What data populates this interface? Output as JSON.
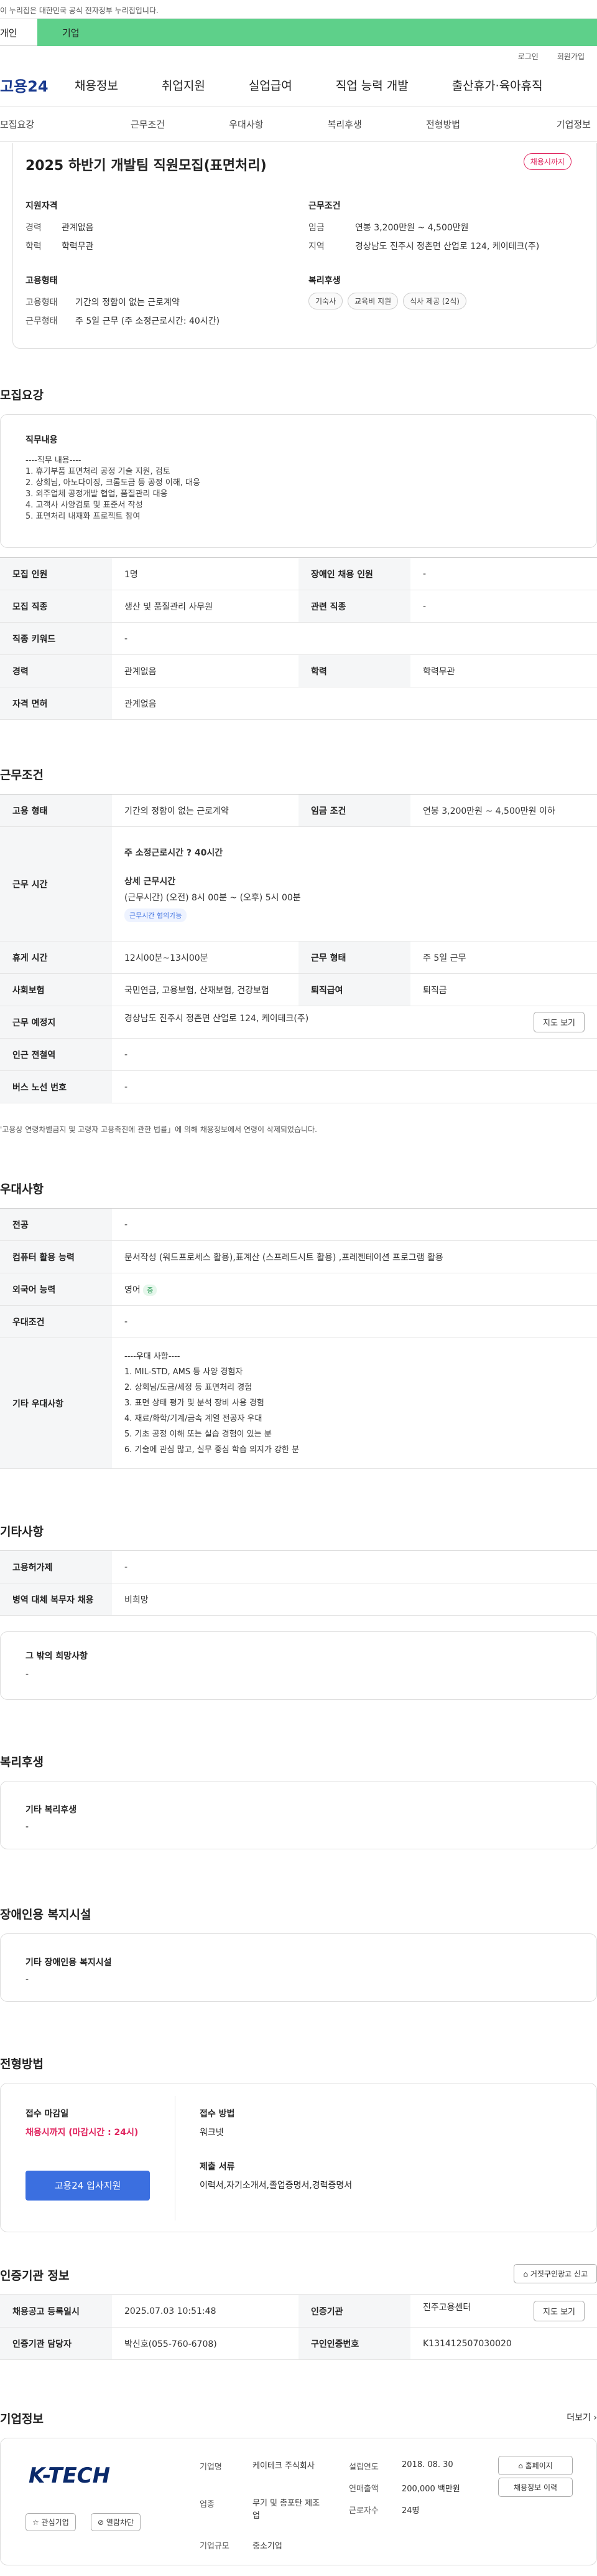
{
  "gov_banner": "이 누리집은 대한민국 공식 전자정부 누리집입니다.",
  "topbar": {
    "tab_personal": "개인",
    "tab_company": "기업"
  },
  "util": {
    "login": "로그인",
    "signup": "회원가입"
  },
  "gnb": {
    "logo": "고용24",
    "items": [
      "채용정보",
      "취업지원",
      "실업급여",
      "직업 능력 개발",
      "출산휴가·육아휴직"
    ]
  },
  "subnav": [
    "모집요강",
    "근무조건",
    "우대사항",
    "복리후생",
    "전형방법",
    "기업정보"
  ],
  "summary": {
    "title": "2025 하반기 개발팀 직원모집(표면처리)",
    "status": "채용시까지",
    "qual_title": "지원자격",
    "career_label": "경력",
    "career": "관계없음",
    "edu_label": "학력",
    "edu": "학력무관",
    "cond_title": "근무조건",
    "wage_label": "임금",
    "wage": "연봉 3,200만원 ~ 4,500만원",
    "region_label": "지역",
    "region": "경상남도 진주시 정촌면 산업로 124, 케이테크(주)",
    "emp_title": "고용형태",
    "emp_type_label": "고용형태",
    "emp_type": "기간의 정함이 없는 근로계약",
    "work_label": "근무형태",
    "work": "주 5일 근무 (주 소정근로시간: 40시간)",
    "welfare_title": "복리후생",
    "welfare_tags": [
      "기숙사",
      "교육비 지원",
      "식사 제공 (2식)"
    ]
  },
  "recruit": {
    "title": "모집요강",
    "duty_title": "직무내용",
    "duty_lines": [
      "----직무 내용----",
      "1. 휴기부품 표면처리 공정 기술 지원, 검토",
      "2. 상회님, 아노다이징, 크롬도금 등 공정 이해, 대응",
      "3. 외주업체 공정개발 협업, 품질관리 대응",
      "4. 고객사 사양검토 및 표준서 작성",
      "5. 표면처리 내재화 프로젝트 참여"
    ],
    "rows": [
      {
        "h1": "모집 인원",
        "v1": "1명",
        "h2": "장애인 채용 인원",
        "v2": "-"
      },
      {
        "h1": "모집 직종",
        "v1": "생산 및 품질관리 사무원",
        "h2": "관련 직종",
        "v2": "-"
      },
      {
        "h1": "직종 키워드",
        "v1": "-"
      },
      {
        "h1": "경력",
        "v1": "관계없음",
        "h2": "학력",
        "v2": "학력무관"
      },
      {
        "h1": "자격 면허",
        "v1": "관계없음"
      }
    ]
  },
  "work": {
    "title": "근무조건",
    "emp_h": "고용 형태",
    "emp_v": "기간의 정함이 없는 근로계약",
    "wage_h": "임금 조건",
    "wage_v": "연봉 3,200만원 ~ 4,500만원 이하",
    "time_h": "근무 시간",
    "time_hours": "주 소정근로시간 ? 40시간",
    "time_detail_title": "상세 근무시간",
    "time_detail": "(근무시간) (오전) 8시 00분 ~ (오후) 5시 00분",
    "time_tag": "근무시간 협의가능",
    "break_h": "휴게 시간",
    "break_v": "12시00분~13시00분",
    "form_h": "근무 형태",
    "form_v": "주 5일 근무",
    "ins_h": "사회보험",
    "ins_v": "국민연금, 고용보험, 산재보험, 건강보험",
    "ret_h": "퇴직급여",
    "ret_v": "퇴직금",
    "place_h": "근무 예정지",
    "place_v": "경상남도 진주시 정촌면 산업로 124, 케이테크(주)",
    "map_btn": "지도 보기",
    "sub_h": "인근 전철역",
    "sub_v": "-",
    "bus_h": "버스 노선 번호",
    "bus_v": "-",
    "note": "'고용상 연령차별금지 및 고령자 고용촉진에 관한 법률」에 의해 채용정보에서 연령이 삭제되었습니다."
  },
  "pref": {
    "title": "우대사항",
    "major_h": "전공",
    "major_v": "-",
    "pc_h": "컴퓨터 활용 능력",
    "pc_v": "문서작성 (워드프로세스 활용),표계산 (스프레드시트 활용) ,프레젠테이션 프로그램 활용",
    "lang_h": "외국어 능력",
    "lang_v": "영어",
    "lang_badge": "중",
    "cond_h": "우대조건",
    "cond_v": "-",
    "etc_h": "기타 우대사항",
    "etc_lines": [
      "----우대 사항----",
      "1. MIL-STD, AMS 등 사양 경험자",
      "2. 상회님/도금/세정 등 표면처리 경험",
      "3. 표면 상태 평가 및 분석 장비 사용 경험",
      "4. 재료/화학/기계/금속 계열 전공자 우대",
      "5. 기초 공정 이해 또는 실습 경험이 있는 분",
      "6. 기술에 관심 많고, 실무 중심 학습 의지가 강한 분"
    ]
  },
  "etc": {
    "title": "기타사항",
    "emp_h": "고용허가제",
    "emp_v": "-",
    "mil_h": "병역 대체 복무자 채용",
    "mil_v": "비희망",
    "other_title": "그 밖의 희망사항",
    "other_v": "-"
  },
  "welfare": {
    "title": "복리후생",
    "sub": "기타 복리후생",
    "v": "-"
  },
  "disab": {
    "title": "장애인용 복지시설",
    "sub": "기타 장애인용 복지시설",
    "v": "-"
  },
  "process": {
    "title": "전형방법",
    "deadline_title": "접수 마감일",
    "deadline": "채용시까지 (마감시간 : 24시)",
    "apply_btn": "고용24 입사지원",
    "method_title": "접수 방법",
    "method": "워크넷",
    "docs_title": "제출 서류",
    "docs": "이력서,자기소개서,졸업증명서,경력증명서"
  },
  "agency": {
    "title": "인증기관 정보",
    "report_btn": "거짓구인광고 신고",
    "reg_h": "채용공고 등록일시",
    "reg_v": "2025.07.03 10:51:48",
    "ag_h": "인증기관",
    "ag_v": "진주고용센터",
    "map_btn": "지도 보기",
    "mgr_h": "인증기관 담당자",
    "mgr_v": "박신호(055-760-6708)",
    "no_h": "구인인증번호",
    "no_v": "K131412507030020"
  },
  "company": {
    "title": "기업정보",
    "more": "더보기",
    "logo": "K-TECH",
    "fav": "관심기업",
    "block": "열람차단",
    "name_h": "기업명",
    "name_v": "케이테크 주식회사",
    "est_h": "설립연도",
    "est_v": "2018. 08. 30",
    "ind_h": "업종",
    "ind_v": "무기 및 총포탄 제조업",
    "sales_h": "연매출액",
    "sales_v": "200,000 백만원",
    "emp_h": "근로자수",
    "emp_v": "24명",
    "size_h": "기업규모",
    "size_v": "중소기업",
    "home_btn": "홈페이지",
    "jobs_btn": "채용정보 이력"
  },
  "colors": {
    "accent": "#5ed08a",
    "primary": "#3b6fe0",
    "alert": "#e0245e"
  }
}
